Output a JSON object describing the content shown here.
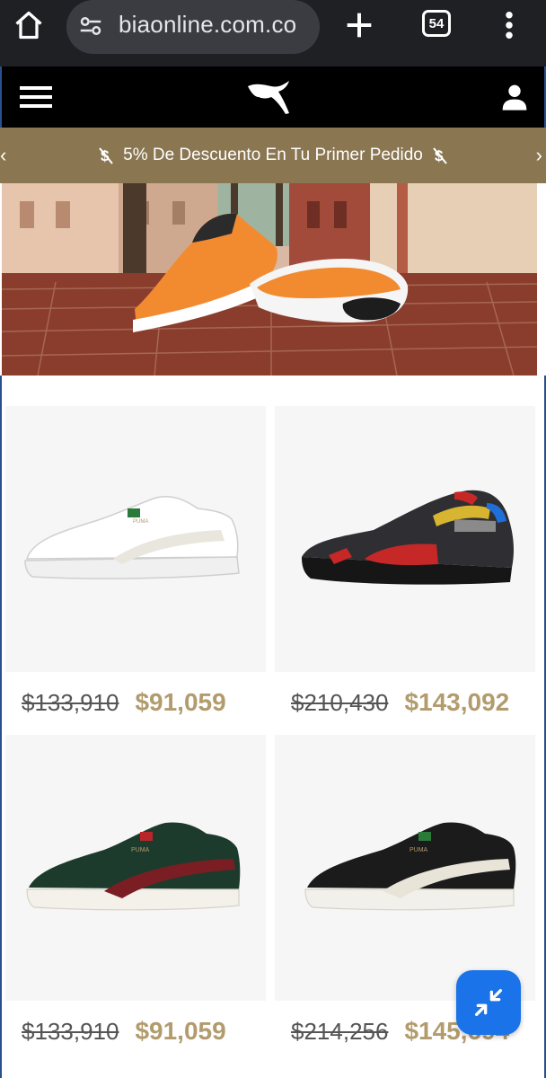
{
  "browser": {
    "url": "biaonline.com.co",
    "tab_count": "54"
  },
  "promo": {
    "text": "5% De Descuento En Tu Primer Pedido"
  },
  "products": [
    {
      "old_price": "$133,910",
      "new_price": "$91,059",
      "shoe": "white-leather-sneaker"
    },
    {
      "old_price": "$210,430",
      "new_price": "$143,092",
      "shoe": "black-red-runner"
    },
    {
      "old_price": "$133,910",
      "new_price": "$91,059",
      "shoe": "green-burgundy-suede"
    },
    {
      "old_price": "$214,256",
      "new_price": "$145,694",
      "shoe": "black-suede"
    }
  ],
  "colors": {
    "brand_gold": "#b29b6d",
    "promo_bg": "#8a7651",
    "header_bg": "#000000",
    "fab_blue": "#1a73e8"
  }
}
